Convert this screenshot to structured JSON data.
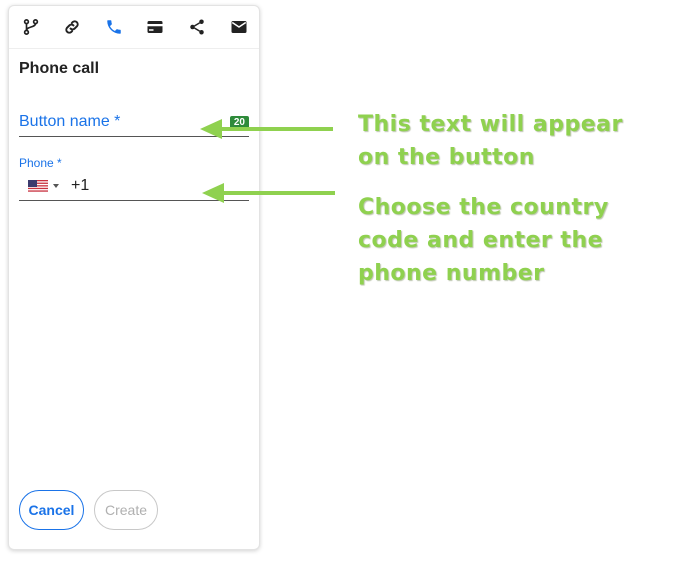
{
  "toolbar": {
    "icons": [
      "branch-icon",
      "link-icon",
      "phone-icon",
      "card-icon",
      "share-icon",
      "mail-icon"
    ],
    "active": "phone-icon",
    "active_color": "#1a73e8"
  },
  "panel": {
    "title": "Phone call",
    "button_name": {
      "label": "Button name *",
      "counter": "20"
    },
    "phone": {
      "label": "Phone *",
      "dial_code": "+1",
      "country_flag": "us-flag-icon"
    },
    "actions": {
      "cancel": "Cancel",
      "create": "Create"
    }
  },
  "annotations": {
    "color": "#8fd14f",
    "note1": {
      "line1": "This text will appear",
      "line2": "on the button"
    },
    "note2": {
      "line1": "Choose the country",
      "line2": "code and enter the",
      "line3": "phone number"
    }
  }
}
